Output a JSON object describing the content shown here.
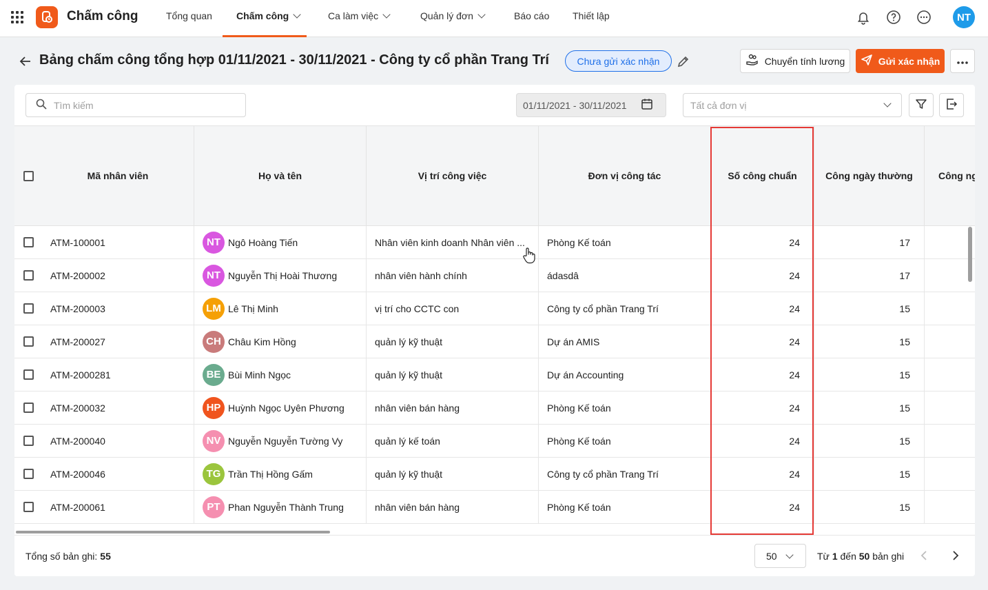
{
  "app": {
    "name": "Chấm công",
    "user_initials": "NT"
  },
  "nav": [
    {
      "label": "Tổng quan",
      "dropdown": false,
      "active": false
    },
    {
      "label": "Chấm công",
      "dropdown": true,
      "active": true
    },
    {
      "label": "Ca làm việc",
      "dropdown": true,
      "active": false
    },
    {
      "label": "Quản lý đơn",
      "dropdown": true,
      "active": false
    },
    {
      "label": "Báo cáo",
      "dropdown": false,
      "active": false
    },
    {
      "label": "Thiết lập",
      "dropdown": false,
      "active": false
    }
  ],
  "header": {
    "title": "Bảng chấm công tổng hợp 01/11/2021 - 30/11/2021 - Công ty cổ phần Trang Trí",
    "status": "Chưa gửi xác nhận",
    "transfer_label": "Chuyển tính lương",
    "send_label": "Gửi xác nhận"
  },
  "filters": {
    "search_placeholder": "Tìm kiếm",
    "date_range": "01/11/2021 - 30/11/2021",
    "unit_placeholder": "Tất cả đơn vị"
  },
  "columns": [
    "Mã nhân viên",
    "Họ và tên",
    "Vị trí công việc",
    "Đơn vị công tác",
    "Số công chuẩn",
    "Công ngày thường",
    "Công ng"
  ],
  "rows": [
    {
      "code": "ATM-100001",
      "initials": "NT",
      "avatar_color": "#d957e0",
      "name": "Ngô Hoàng Tiến",
      "position": "Nhân viên kinh doanh Nhân viên ...",
      "unit": "Phòng Kế toán",
      "standard": "24",
      "normal": "17"
    },
    {
      "code": "ATM-200002",
      "initials": "NT",
      "avatar_color": "#d957e0",
      "name": "Nguyễn Thị Hoài Thương",
      "position": "nhân viên hành chính",
      "unit": "ádasdâ",
      "standard": "24",
      "normal": "17"
    },
    {
      "code": "ATM-200003",
      "initials": "LM",
      "avatar_color": "#f5a006",
      "name": "Lê Thị Minh",
      "position": "vị trí cho CCTC con",
      "unit": "Công ty cổ phần Trang Trí",
      "standard": "24",
      "normal": "15"
    },
    {
      "code": "ATM-200027",
      "initials": "CH",
      "avatar_color": "#c97b7b",
      "name": "Châu Kim Hồng",
      "position": "quản lý kỹ thuật",
      "unit": "Dự án AMIS",
      "standard": "24",
      "normal": "15"
    },
    {
      "code": "ATM-2000281",
      "initials": "BE",
      "avatar_color": "#6aab8e",
      "name": "Bùi Minh Ngọc",
      "position": "quản lý kỹ thuật",
      "unit": "Dự án Accounting",
      "standard": "24",
      "normal": "15"
    },
    {
      "code": "ATM-200032",
      "initials": "HP",
      "avatar_color": "#f0541e",
      "name": "Huỳnh Ngọc Uyên Phương",
      "position": "nhân viên bán hàng",
      "unit": "Phòng Kế toán",
      "standard": "24",
      "normal": "15"
    },
    {
      "code": "ATM-200040",
      "initials": "NV",
      "avatar_color": "#f58fb0",
      "name": "Nguyễn Nguyễn Tường Vy",
      "position": "quản lý kế toán",
      "unit": "Phòng Kế toán",
      "standard": "24",
      "normal": "15"
    },
    {
      "code": "ATM-200046",
      "initials": "TG",
      "avatar_color": "#9bc53d",
      "name": "Trần Thị Hồng Gấm",
      "position": "quản lý kỹ thuật",
      "unit": "Công ty cổ phần Trang Trí",
      "standard": "24",
      "normal": "15"
    },
    {
      "code": "ATM-200061",
      "initials": "PT",
      "avatar_color": "#f58fb0",
      "name": "Phan Nguyễn Thành Trung",
      "position": "nhân viên bán hàng",
      "unit": "Phòng Kế toán",
      "standard": "24",
      "normal": "15"
    }
  ],
  "footer": {
    "total_label": "Tổng số bản ghi:",
    "total_value": "55",
    "page_size": "50",
    "range_from_label": "Từ",
    "range_from": "1",
    "range_to_label": "đến",
    "range_to": "50",
    "range_suffix": "bản ghi"
  }
}
